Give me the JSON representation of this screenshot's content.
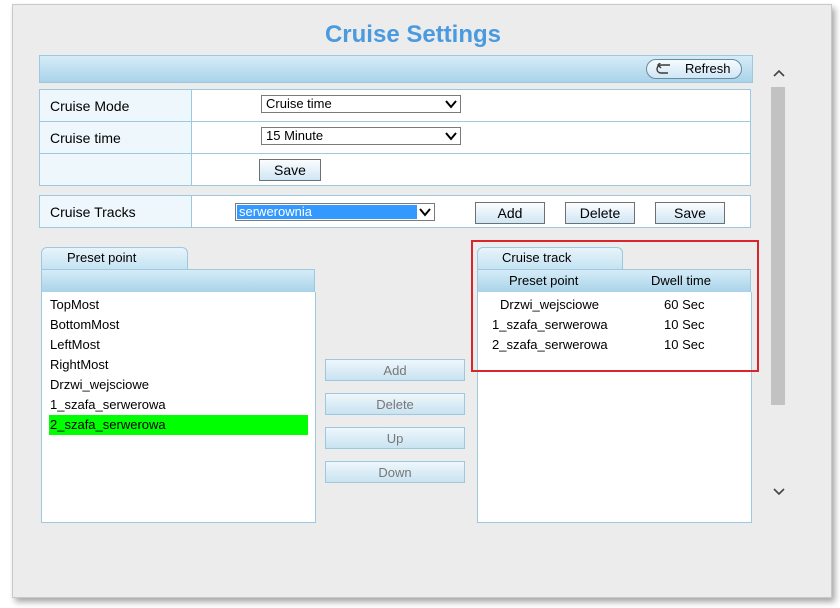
{
  "page": {
    "title": "Cruise Settings"
  },
  "toolbar": {
    "refresh_label": "Refresh"
  },
  "settings": {
    "cruise_mode_label": "Cruise Mode",
    "cruise_mode_value": "Cruise time",
    "cruise_time_label": "Cruise time",
    "cruise_time_value": "15 Minute",
    "save_label": "Save"
  },
  "tracks": {
    "label": "Cruise Tracks",
    "selected": "serwerownia",
    "add_label": "Add",
    "delete_label": "Delete",
    "save_label": "Save"
  },
  "preset_panel": {
    "tab_label": "Preset point",
    "items": [
      "TopMost",
      "BottomMost",
      "LeftMost",
      "RightMost",
      "Drzwi_wejsciowe",
      "1_szafa_serwerowa",
      "2_szafa_serwerowa"
    ],
    "selected_item": "2_szafa_serwerowa",
    "selected_color": "#00ff00"
  },
  "actions": {
    "add": "Add",
    "delete": "Delete",
    "up": "Up",
    "down": "Down"
  },
  "track_panel": {
    "tab_label": "Cruise track",
    "col_preset": "Preset point",
    "col_dwell": "Dwell time",
    "rows": [
      {
        "preset": "Drzwi_wejsciowe",
        "dwell": "60 Sec"
      },
      {
        "preset": "1_szafa_serwerowa",
        "dwell": "10 Sec"
      },
      {
        "preset": "2_szafa_serwerowa",
        "dwell": "10 Sec"
      }
    ]
  },
  "colors": {
    "accent": "#4a9ae0",
    "highlight_box": "#d9262c",
    "bar": "#a9d3ea"
  }
}
